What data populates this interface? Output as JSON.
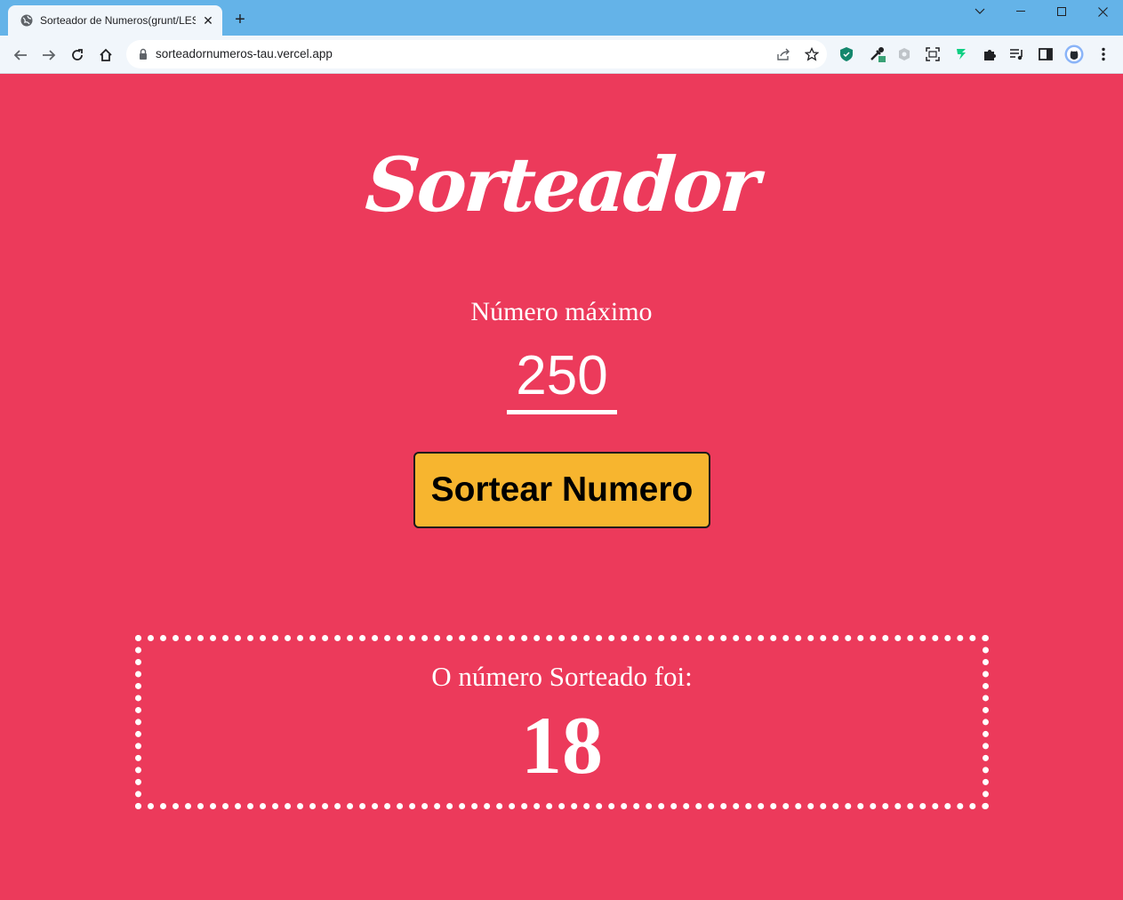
{
  "browser": {
    "tab_title": "Sorteador de Numeros(grunt/LESS)",
    "url": "sorteadornumeros-tau.vercel.app",
    "icons": [
      "globe-icon",
      "close-icon",
      "plus-icon",
      "chevron-down-icon",
      "minimize-icon",
      "maximize-icon",
      "close-window-icon",
      "back-icon",
      "forward-icon",
      "reload-icon",
      "home-icon",
      "lock-icon",
      "share-icon",
      "star-icon",
      "shield-icon",
      "eyedropper-icon",
      "extension-icon",
      "screenshot-icon",
      "figma-icon",
      "puzzle-icon",
      "media-icon",
      "sidepanel-icon",
      "github-icon",
      "menu-icon"
    ],
    "colors": {
      "titlebar": "#64b3e8",
      "toolbar": "#f1f6fb"
    }
  },
  "app": {
    "logo": "Sorteador",
    "max_label": "Número máximo",
    "max_value": "250",
    "button_label": "Sortear Numero",
    "result_label": "O número Sorteado foi:",
    "result_value": "18",
    "colors": {
      "background": "#ec3a5b",
      "button": "#f7b52f",
      "text": "#ffffff"
    }
  }
}
